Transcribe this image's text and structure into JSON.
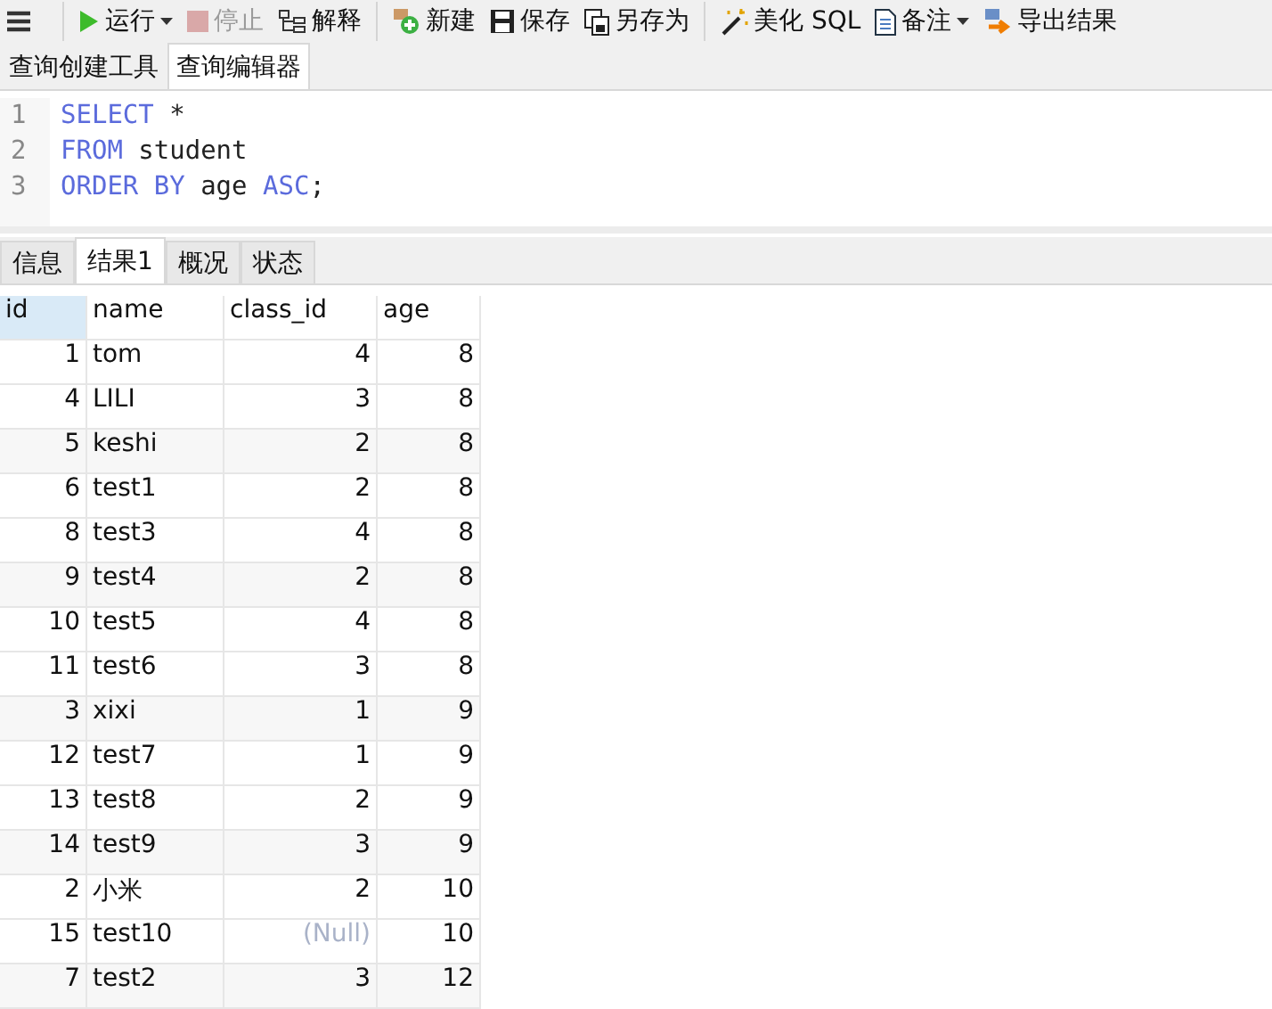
{
  "toolbar": [
    {
      "kind": "menu"
    },
    {
      "kind": "sep"
    },
    {
      "kind": "run",
      "label": "运行",
      "caret": true,
      "disabled": false
    },
    {
      "kind": "stop",
      "label": "停止",
      "disabled": true
    },
    {
      "kind": "explain",
      "label": "解释",
      "disabled": false
    },
    {
      "kind": "sep"
    },
    {
      "kind": "new",
      "label": "新建",
      "disabled": false
    },
    {
      "kind": "save",
      "label": "保存",
      "disabled": false
    },
    {
      "kind": "saveas",
      "label": "另存为",
      "disabled": false
    },
    {
      "kind": "sep"
    },
    {
      "kind": "beautify",
      "label": "美化 SQL",
      "disabled": false
    },
    {
      "kind": "note",
      "label": "备注",
      "caret": true,
      "disabled": false
    },
    {
      "kind": "export",
      "label": "导出结果",
      "disabled": false
    }
  ],
  "tabs": [
    {
      "label": "查询创建工具",
      "selected": false
    },
    {
      "label": "查询编辑器",
      "selected": true
    }
  ],
  "editor": {
    "line_numbers": [
      "1",
      "2",
      "3"
    ],
    "lines": [
      [
        {
          "kind": "kw",
          "text": "SELECT"
        },
        {
          "kind": "op",
          "text": " *"
        }
      ],
      [
        {
          "kind": "kw",
          "text": "FROM"
        },
        {
          "kind": "id",
          "text": " student"
        }
      ],
      [
        {
          "kind": "kw",
          "text": "ORDER BY"
        },
        {
          "kind": "id",
          "text": " age "
        },
        {
          "kind": "kw",
          "text": "ASC"
        },
        {
          "kind": "op",
          "text": ";"
        }
      ]
    ]
  },
  "result_tabs": [
    {
      "label": "信息",
      "selected": false
    },
    {
      "label": "结果1",
      "selected": true
    },
    {
      "label": "概况",
      "selected": false
    },
    {
      "label": "状态",
      "selected": false
    }
  ],
  "table": {
    "columns": [
      {
        "label": "id",
        "kind": "number",
        "selected": true
      },
      {
        "label": "name",
        "kind": "text",
        "selected": false
      },
      {
        "label": "class_id",
        "kind": "number",
        "selected": false
      },
      {
        "label": "age",
        "kind": "number",
        "selected": false
      }
    ],
    "rows": [
      [
        "1",
        "tom",
        "4",
        "8"
      ],
      [
        "4",
        "LILI",
        "3",
        "8"
      ],
      [
        "5",
        "keshi",
        "2",
        "8"
      ],
      [
        "6",
        "test1",
        "2",
        "8"
      ],
      [
        "8",
        "test3",
        "4",
        "8"
      ],
      [
        "9",
        "test4",
        "2",
        "8"
      ],
      [
        "10",
        "test5",
        "4",
        "8"
      ],
      [
        "11",
        "test6",
        "3",
        "8"
      ],
      [
        "3",
        "xixi",
        "1",
        "9"
      ],
      [
        "12",
        "test7",
        "1",
        "9"
      ],
      [
        "13",
        "test8",
        "2",
        "9"
      ],
      [
        "14",
        "test9",
        "3",
        "9"
      ],
      [
        "2",
        "小米",
        "2",
        "10"
      ],
      [
        "15",
        "test10",
        null,
        "10"
      ],
      [
        "7",
        "test2",
        "3",
        "12"
      ]
    ],
    "null_text": "(Null)"
  }
}
